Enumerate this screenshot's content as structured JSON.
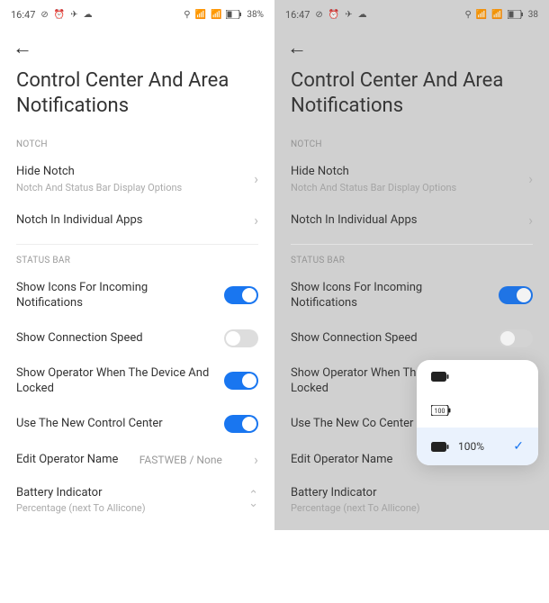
{
  "left": {
    "status": {
      "time": "16:47",
      "battery": "38%"
    },
    "title": "Control Center And Area Notifications",
    "sections": {
      "notch": {
        "label": "NOTCH",
        "hide_notch": {
          "label": "Hide Notch",
          "sub": "Notch And Status Bar Display Options"
        },
        "individual": {
          "label": "Notch In Individual Apps"
        }
      },
      "statusbar": {
        "label": "STATUS BAR",
        "show_icons": {
          "label": "Show Icons For Incoming Notifications",
          "on": true
        },
        "conn_speed": {
          "label": "Show Connection Speed",
          "on": false
        },
        "operator_locked": {
          "label": "Show Operator When The Device And Locked",
          "on": true
        },
        "new_cc": {
          "label": "Use The New Control Center",
          "on": true
        },
        "edit_operator": {
          "label": "Edit Operator Name",
          "value": "FASTWEB / None"
        },
        "battery_ind": {
          "label": "Battery Indicator",
          "sub": "Percentage (next To Allicone)"
        }
      }
    }
  },
  "right": {
    "status": {
      "time": "16:47",
      "battery": "38"
    },
    "title": "Control Center And Area Notifications",
    "sections": {
      "notch": {
        "label": "NOTCH",
        "hide_notch": {
          "label": "Hide Notch",
          "sub": "Notch And Status Bar Display Options"
        },
        "individual": {
          "label": "Notch In Individual Apps"
        }
      },
      "statusbar": {
        "label": "STATUS BAR",
        "show_icons": {
          "label": "Show Icons For Incoming Notifications",
          "on": true
        },
        "conn_speed": {
          "label": "Show Connection Speed",
          "on": false
        },
        "operator_locked": {
          "label": "Show Operator When The Device And Locked",
          "on": true
        },
        "new_cc": {
          "label": "Use The New Co Center"
        },
        "edit_operator": {
          "label": "Edit Operator Name"
        },
        "battery_ind": {
          "label": "Battery Indicator",
          "sub": "Percentage (next To Allicone)"
        }
      }
    },
    "popup": {
      "opt3_text": "100%"
    }
  }
}
